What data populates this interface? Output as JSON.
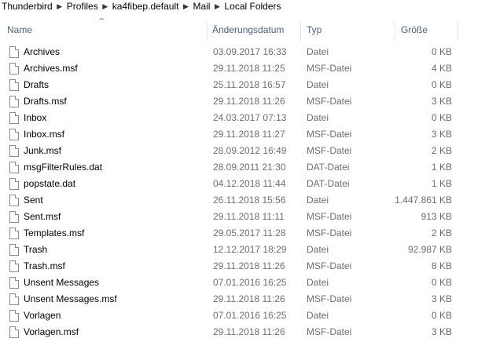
{
  "breadcrumb": [
    "Thunderbird",
    "Profiles",
    "ka4fibep.default",
    "Mail",
    "Local Folders"
  ],
  "columns": {
    "name": "Name",
    "date": "Änderungsdatum",
    "type": "Typ",
    "size": "Größe"
  },
  "sort": {
    "column": "name",
    "direction": "ascending",
    "icon": "sort-ascending-icon"
  },
  "files": [
    {
      "name": "Archives",
      "date": "03.09.2017 16:33",
      "type": "Datei",
      "size": "0 KB"
    },
    {
      "name": "Archives.msf",
      "date": "29.11.2018 11:25",
      "type": "MSF-Datei",
      "size": "4 KB"
    },
    {
      "name": "Drafts",
      "date": "25.11.2018 16:57",
      "type": "Datei",
      "size": "0 KB"
    },
    {
      "name": "Drafts.msf",
      "date": "29.11.2018 11:26",
      "type": "MSF-Datei",
      "size": "3 KB"
    },
    {
      "name": "Inbox",
      "date": "24.03.2017 07:13",
      "type": "Datei",
      "size": "0 KB"
    },
    {
      "name": "Inbox.msf",
      "date": "29.11.2018 11:27",
      "type": "MSF-Datei",
      "size": "3 KB"
    },
    {
      "name": "Junk.msf",
      "date": "28.09.2012 16:49",
      "type": "MSF-Datei",
      "size": "2 KB"
    },
    {
      "name": "msgFilterRules.dat",
      "date": "28.09.2011 21:30",
      "type": "DAT-Datei",
      "size": "1 KB"
    },
    {
      "name": "popstate.dat",
      "date": "04.12.2018 11:44",
      "type": "DAT-Datei",
      "size": "1 KB"
    },
    {
      "name": "Sent",
      "date": "26.11.2018 15:56",
      "type": "Datei",
      "size": "1.447.861 KB"
    },
    {
      "name": "Sent.msf",
      "date": "29.11.2018 11:11",
      "type": "MSF-Datei",
      "size": "913 KB"
    },
    {
      "name": "Templates.msf",
      "date": "29.05.2017 11:28",
      "type": "MSF-Datei",
      "size": "2 KB"
    },
    {
      "name": "Trash",
      "date": "12.12.2017 18:29",
      "type": "Datei",
      "size": "92.987 KB"
    },
    {
      "name": "Trash.msf",
      "date": "29.11.2018 11:26",
      "type": "MSF-Datei",
      "size": "8 KB"
    },
    {
      "name": "Unsent Messages",
      "date": "07.01.2016 16:25",
      "type": "Datei",
      "size": "0 KB"
    },
    {
      "name": "Unsent Messages.msf",
      "date": "29.11.2018 11:26",
      "type": "MSF-Datei",
      "size": "3 KB"
    },
    {
      "name": "Vorlagen",
      "date": "07.01.2016 16:25",
      "type": "Datei",
      "size": "0 KB"
    },
    {
      "name": "Vorlagen.msf",
      "date": "29.11.2018 11:26",
      "type": "MSF-Datei",
      "size": "3 KB"
    }
  ]
}
